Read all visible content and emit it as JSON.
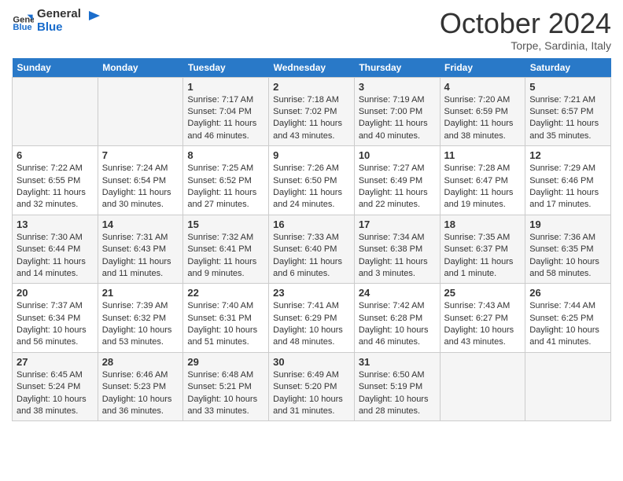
{
  "header": {
    "logo_general": "General",
    "logo_blue": "Blue",
    "month": "October 2024",
    "location": "Torpe, Sardinia, Italy"
  },
  "weekdays": [
    "Sunday",
    "Monday",
    "Tuesday",
    "Wednesday",
    "Thursday",
    "Friday",
    "Saturday"
  ],
  "weeks": [
    [
      {
        "num": "",
        "info": ""
      },
      {
        "num": "",
        "info": ""
      },
      {
        "num": "1",
        "info": "Sunrise: 7:17 AM\nSunset: 7:04 PM\nDaylight: 11 hours and 46 minutes."
      },
      {
        "num": "2",
        "info": "Sunrise: 7:18 AM\nSunset: 7:02 PM\nDaylight: 11 hours and 43 minutes."
      },
      {
        "num": "3",
        "info": "Sunrise: 7:19 AM\nSunset: 7:00 PM\nDaylight: 11 hours and 40 minutes."
      },
      {
        "num": "4",
        "info": "Sunrise: 7:20 AM\nSunset: 6:59 PM\nDaylight: 11 hours and 38 minutes."
      },
      {
        "num": "5",
        "info": "Sunrise: 7:21 AM\nSunset: 6:57 PM\nDaylight: 11 hours and 35 minutes."
      }
    ],
    [
      {
        "num": "6",
        "info": "Sunrise: 7:22 AM\nSunset: 6:55 PM\nDaylight: 11 hours and 32 minutes."
      },
      {
        "num": "7",
        "info": "Sunrise: 7:24 AM\nSunset: 6:54 PM\nDaylight: 11 hours and 30 minutes."
      },
      {
        "num": "8",
        "info": "Sunrise: 7:25 AM\nSunset: 6:52 PM\nDaylight: 11 hours and 27 minutes."
      },
      {
        "num": "9",
        "info": "Sunrise: 7:26 AM\nSunset: 6:50 PM\nDaylight: 11 hours and 24 minutes."
      },
      {
        "num": "10",
        "info": "Sunrise: 7:27 AM\nSunset: 6:49 PM\nDaylight: 11 hours and 22 minutes."
      },
      {
        "num": "11",
        "info": "Sunrise: 7:28 AM\nSunset: 6:47 PM\nDaylight: 11 hours and 19 minutes."
      },
      {
        "num": "12",
        "info": "Sunrise: 7:29 AM\nSunset: 6:46 PM\nDaylight: 11 hours and 17 minutes."
      }
    ],
    [
      {
        "num": "13",
        "info": "Sunrise: 7:30 AM\nSunset: 6:44 PM\nDaylight: 11 hours and 14 minutes."
      },
      {
        "num": "14",
        "info": "Sunrise: 7:31 AM\nSunset: 6:43 PM\nDaylight: 11 hours and 11 minutes."
      },
      {
        "num": "15",
        "info": "Sunrise: 7:32 AM\nSunset: 6:41 PM\nDaylight: 11 hours and 9 minutes."
      },
      {
        "num": "16",
        "info": "Sunrise: 7:33 AM\nSunset: 6:40 PM\nDaylight: 11 hours and 6 minutes."
      },
      {
        "num": "17",
        "info": "Sunrise: 7:34 AM\nSunset: 6:38 PM\nDaylight: 11 hours and 3 minutes."
      },
      {
        "num": "18",
        "info": "Sunrise: 7:35 AM\nSunset: 6:37 PM\nDaylight: 11 hours and 1 minute."
      },
      {
        "num": "19",
        "info": "Sunrise: 7:36 AM\nSunset: 6:35 PM\nDaylight: 10 hours and 58 minutes."
      }
    ],
    [
      {
        "num": "20",
        "info": "Sunrise: 7:37 AM\nSunset: 6:34 PM\nDaylight: 10 hours and 56 minutes."
      },
      {
        "num": "21",
        "info": "Sunrise: 7:39 AM\nSunset: 6:32 PM\nDaylight: 10 hours and 53 minutes."
      },
      {
        "num": "22",
        "info": "Sunrise: 7:40 AM\nSunset: 6:31 PM\nDaylight: 10 hours and 51 minutes."
      },
      {
        "num": "23",
        "info": "Sunrise: 7:41 AM\nSunset: 6:29 PM\nDaylight: 10 hours and 48 minutes."
      },
      {
        "num": "24",
        "info": "Sunrise: 7:42 AM\nSunset: 6:28 PM\nDaylight: 10 hours and 46 minutes."
      },
      {
        "num": "25",
        "info": "Sunrise: 7:43 AM\nSunset: 6:27 PM\nDaylight: 10 hours and 43 minutes."
      },
      {
        "num": "26",
        "info": "Sunrise: 7:44 AM\nSunset: 6:25 PM\nDaylight: 10 hours and 41 minutes."
      }
    ],
    [
      {
        "num": "27",
        "info": "Sunrise: 6:45 AM\nSunset: 5:24 PM\nDaylight: 10 hours and 38 minutes."
      },
      {
        "num": "28",
        "info": "Sunrise: 6:46 AM\nSunset: 5:23 PM\nDaylight: 10 hours and 36 minutes."
      },
      {
        "num": "29",
        "info": "Sunrise: 6:48 AM\nSunset: 5:21 PM\nDaylight: 10 hours and 33 minutes."
      },
      {
        "num": "30",
        "info": "Sunrise: 6:49 AM\nSunset: 5:20 PM\nDaylight: 10 hours and 31 minutes."
      },
      {
        "num": "31",
        "info": "Sunrise: 6:50 AM\nSunset: 5:19 PM\nDaylight: 10 hours and 28 minutes."
      },
      {
        "num": "",
        "info": ""
      },
      {
        "num": "",
        "info": ""
      }
    ]
  ]
}
